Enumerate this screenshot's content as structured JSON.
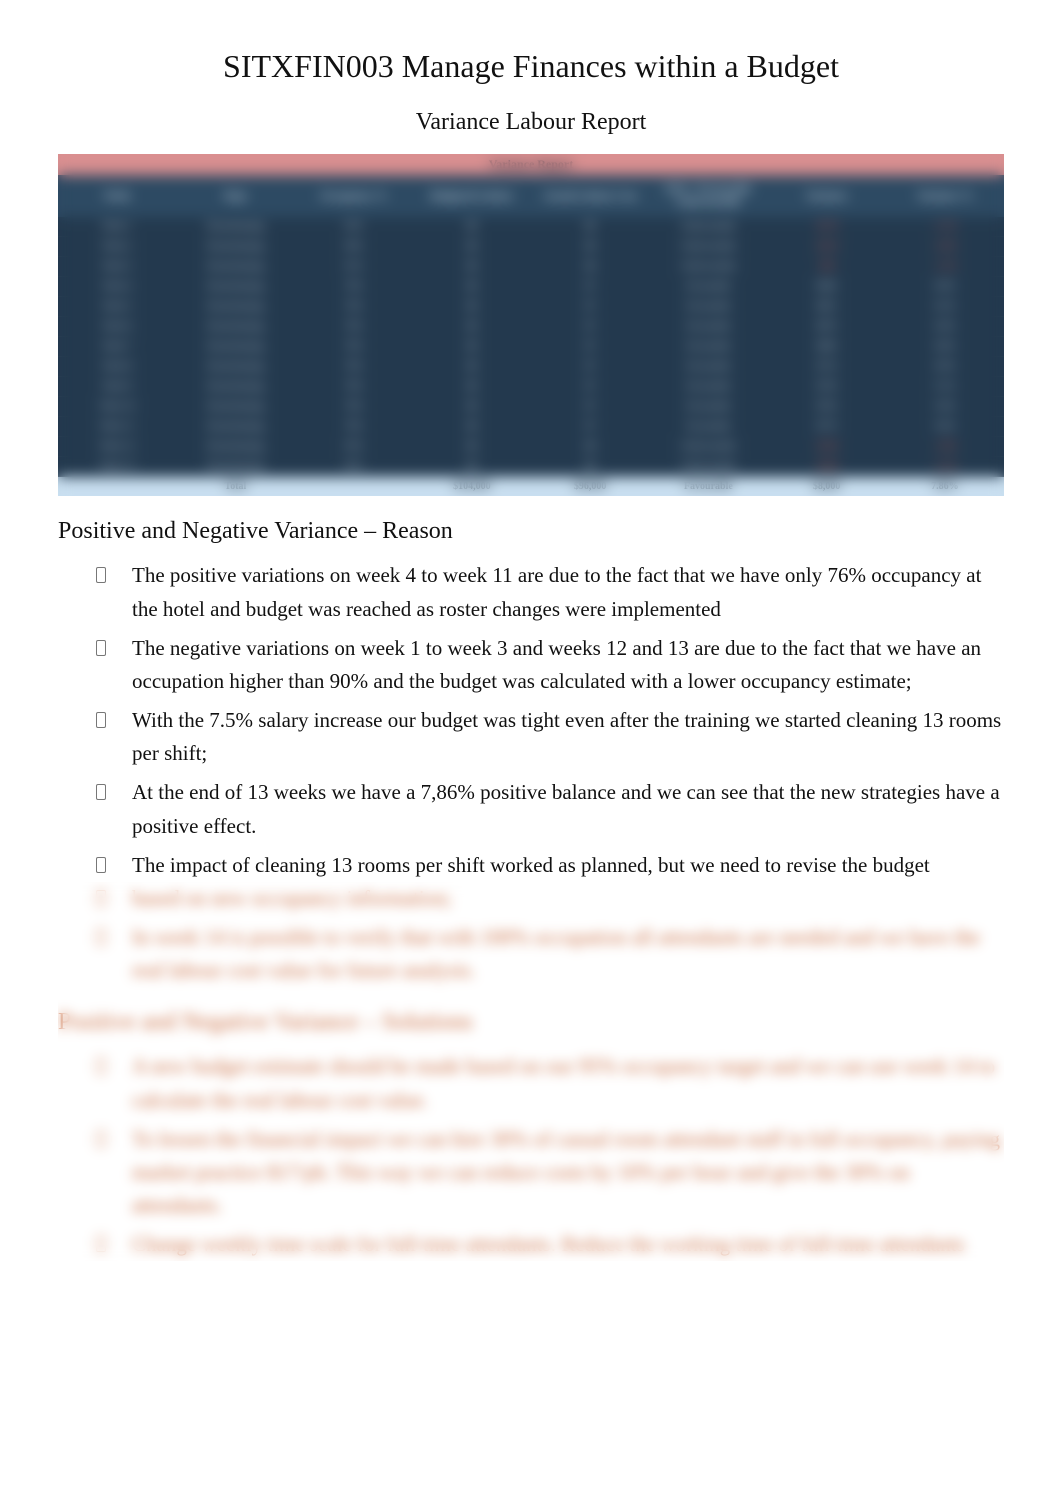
{
  "title": "SITXFIN003 Manage Finances within a Budget",
  "subtitle": "Variance Labour Report",
  "table": {
    "title": "Variance Report",
    "headers": [
      "Week",
      "Dept",
      "Occupancy %",
      "Budgeted Labour",
      "Actual Labour Cost",
      "F&U / Favourable Unfavourable",
      "Variance",
      "Variance %"
    ],
    "rows": [
      {
        "cells": [
          "Week 1",
          "Housekeeping",
          "92%",
          "$8",
          "$8",
          "Unfavourable",
          "-$170",
          "-2.1%"
        ],
        "neg": [
          6,
          7
        ]
      },
      {
        "cells": [
          "Week 2",
          "Housekeeping",
          "94%",
          "$8",
          "$8",
          "Unfavourable",
          "-$210",
          "-2.6%"
        ],
        "neg": [
          6,
          7
        ]
      },
      {
        "cells": [
          "Week 3",
          "Housekeeping",
          "91%",
          "$8",
          "$8",
          "Unfavourable",
          "-$95",
          "-1.2%"
        ],
        "neg": [
          6,
          7
        ]
      },
      {
        "cells": [
          "Week 4",
          "Housekeeping",
          "76%",
          "$8",
          "$7",
          "Favourable",
          "$640",
          "8.0%"
        ],
        "neg": []
      },
      {
        "cells": [
          "Week 5",
          "Housekeeping",
          "76%",
          "$8",
          "$7",
          "Favourable",
          "$655",
          "8.2%"
        ],
        "neg": []
      },
      {
        "cells": [
          "Week 6",
          "Housekeeping",
          "76%",
          "$8",
          "$7",
          "Favourable",
          "$670",
          "8.4%"
        ],
        "neg": []
      },
      {
        "cells": [
          "Week 7",
          "Housekeeping",
          "76%",
          "$8",
          "$7",
          "Favourable",
          "$690",
          "8.6%"
        ],
        "neg": []
      },
      {
        "cells": [
          "Week 8",
          "Housekeeping",
          "76%",
          "$8",
          "$7",
          "Favourable",
          "$710",
          "8.9%"
        ],
        "neg": []
      },
      {
        "cells": [
          "Week 9",
          "Housekeeping",
          "76%",
          "$8",
          "$7",
          "Favourable",
          "$730",
          "9.1%"
        ],
        "neg": []
      },
      {
        "cells": [
          "Week 10",
          "Housekeeping",
          "76%",
          "$8",
          "$7",
          "Favourable",
          "$750",
          "9.4%"
        ],
        "neg": []
      },
      {
        "cells": [
          "Week 11",
          "Housekeeping",
          "76%",
          "$8",
          "$7",
          "Favourable",
          "$770",
          "9.6%"
        ],
        "neg": []
      },
      {
        "cells": [
          "Week 12",
          "Housekeeping",
          "93%",
          "$8",
          "$8",
          "Unfavourable",
          "-$140",
          "-1.8%"
        ],
        "neg": [
          6,
          7
        ]
      },
      {
        "cells": [
          "Week 13",
          "Housekeeping",
          "95%",
          "$8",
          "$8",
          "Unfavourable",
          "-$180",
          "-2.2%"
        ],
        "neg": [
          6,
          7
        ]
      }
    ],
    "footer": [
      "",
      "Total",
      "",
      "$104,000",
      "$96,000",
      "Favourable",
      "$8,000",
      "7.86%"
    ]
  },
  "section1": {
    "heading": "Positive and Negative Variance – Reason",
    "items": [
      "The positive variations on week 4 to week 11 are due to the fact that we have only 76% occupancy at the hotel and budget was reached as roster changes were implemented",
      "The negative variations on week 1 to week 3 and weeks 12 and 13 are due to the fact that we have an occupation higher than 90% and the budget was calculated with a lower occupancy estimate;",
      "With the 7.5% salary increase our budget was tight even after the training we started cleaning 13 rooms per shift;",
      "At the end of 13 weeks we have a 7,86% positive balance and we can see that the new strategies have a positive effect.",
      "The impact of cleaning 13 rooms per shift worked as planned, but we need to revise the budget"
    ]
  },
  "locked": {
    "tail_items": [
      "based on new occupancy information;",
      "In week 14 is possible to verify that with 100% occupation all attendants are needed and we have the real labour cost value for future analysis."
    ],
    "heading": "Positive and Negative Variance – Solutions",
    "items": [
      "A new budget estimate should be made based on our 95% occupancy target and we can use week 14 to calculate the real labour cost value.",
      "To lessen the financial impact we can hire 30% of casual room attendant staff in full occupancy, paying market practice $17/ph. This way we can reduce costs by 10% per hour and give the 30% on attendants.",
      "Change weekly time scale for full-time attendants. Reduce the working time of full-time attendants"
    ]
  }
}
